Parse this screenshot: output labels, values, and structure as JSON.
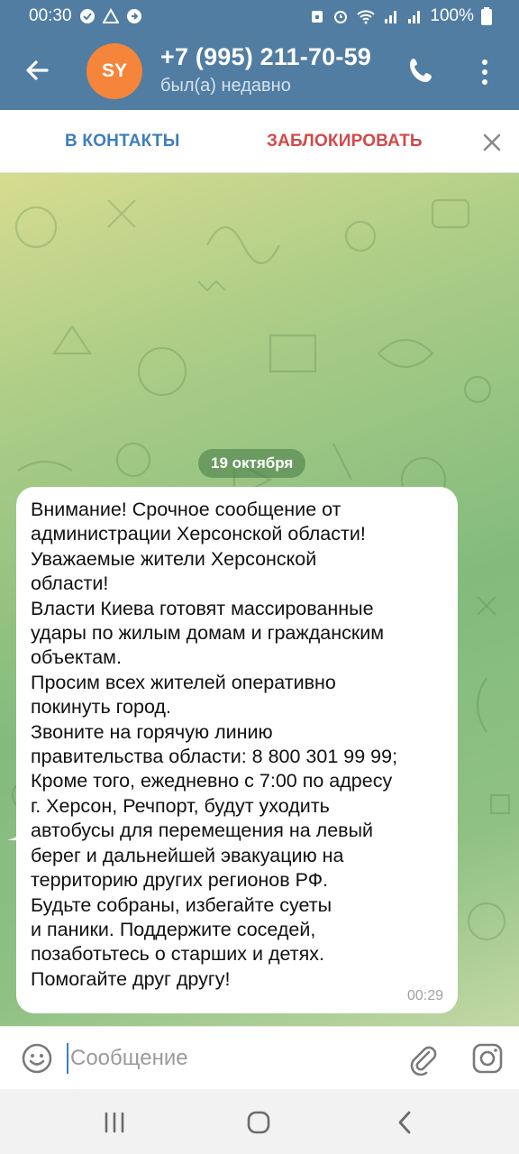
{
  "status_bar": {
    "time": "00:30",
    "battery": "100%"
  },
  "header": {
    "avatar_initials": "SY",
    "contact_name": "+7 (995) 211-70-59",
    "contact_status": "был(а) недавно",
    "colors": {
      "header_bg": "#517da2",
      "avatar_bg": "#f4853a"
    }
  },
  "action_bar": {
    "add_contact_label": "В КОНТАКТЫ",
    "block_label": "ЗАБЛОКИРОВАТЬ"
  },
  "chat": {
    "date_label": "19 октября",
    "message": {
      "text": "Внимание! Срочное сообщение от\nадминистрации Херсонской области!\nУважаемые жители Херсонской\nобласти!\nВласти Киева готовят массированные\nудары по жилым домам и гражданским\nобъектам.\nПросим всех жителей оперативно\nпокинуть город.\nЗвоните на горячую линию\nправительства области: 8 800 301 99 99;\nКроме того, ежедневно с 7:00 по адресу\nг. Херсон, Речпорт,  будут уходить\nавтобусы для перемещения на левый\nберег и дальнейшей эвакуацию на\nтерриторию других регионов РФ.\nБудьте собраны, избегайте суеты\nи паники. Поддержите соседей,\nпозаботьтесь о старших и детях.\nПомогайте друг другу!",
      "time": "00:29"
    }
  },
  "composer": {
    "placeholder": "Сообщение"
  },
  "icons": {
    "back": "arrow-left-icon",
    "call": "phone-icon",
    "more": "more-vertical-icon",
    "close": "close-icon",
    "emoji": "emoji-icon",
    "attach": "paperclip-icon",
    "camera": "instagram-camera-icon",
    "nav_recent": "recent-apps-icon",
    "nav_home": "home-icon",
    "nav_back": "nav-back-icon"
  }
}
